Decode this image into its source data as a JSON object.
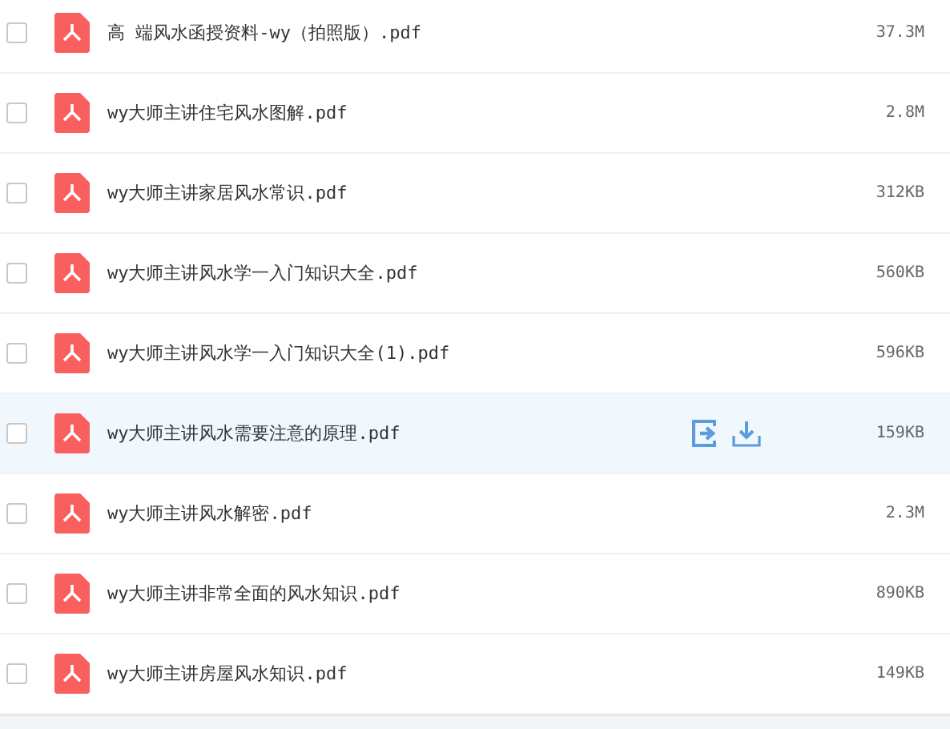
{
  "files": [
    {
      "name": "高 端风水函授资料-wy（拍照版）.pdf",
      "size": "37.3M",
      "checked": false,
      "hovered": false
    },
    {
      "name": "wy大师主讲住宅风水图解.pdf",
      "size": "2.8M",
      "checked": false,
      "hovered": false
    },
    {
      "name": "wy大师主讲家居风水常识.pdf",
      "size": "312KB",
      "checked": false,
      "hovered": false
    },
    {
      "name": "wy大师主讲风水学一入门知识大全.pdf",
      "size": "560KB",
      "checked": false,
      "hovered": false
    },
    {
      "name": "wy大师主讲风水学一入门知识大全(1).pdf",
      "size": "596KB",
      "checked": false,
      "hovered": false
    },
    {
      "name": "wy大师主讲风水需要注意的原理.pdf",
      "size": "159KB",
      "checked": false,
      "hovered": true
    },
    {
      "name": "wy大师主讲风水解密.pdf",
      "size": "2.3M",
      "checked": false,
      "hovered": false
    },
    {
      "name": "wy大师主讲非常全面的风水知识.pdf",
      "size": "890KB",
      "checked": false,
      "hovered": false
    },
    {
      "name": "wy大师主讲房屋风水知识.pdf",
      "size": "149KB",
      "checked": false,
      "hovered": false
    }
  ]
}
